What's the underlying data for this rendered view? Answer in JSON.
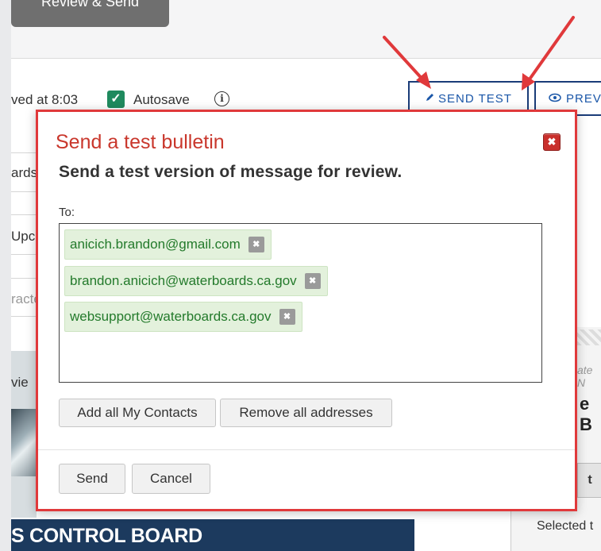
{
  "background": {
    "review_button": "Review & Send",
    "saved_text": "ved at 8:03",
    "autosave_label": "Autosave",
    "info_icon": "i",
    "send_test_label": "SEND TEST",
    "preview_label": "PREV",
    "left_tabs": [
      "ards",
      "Upc",
      "racte"
    ],
    "hero_text": "vie",
    "banner_text": "S CONTROL BOARD",
    "right_small": "ate N",
    "right_bold": "e B",
    "right_box": "t",
    "right_selected": "Selected t"
  },
  "modal": {
    "title": "Send a test bulletin",
    "close": "✖",
    "subtitle": "Send a test version of message for review.",
    "to_label": "To:",
    "recipients": [
      "anicich.brandon@gmail.com",
      "brandon.anicich@waterboards.ca.gov",
      "websupport@waterboards.ca.gov"
    ],
    "chip_remove": "✖",
    "add_all_label": "Add all My Contacts",
    "remove_all_label": "Remove all addresses",
    "send_label": "Send",
    "cancel_label": "Cancel"
  },
  "colors": {
    "accent_red": "#e0393b",
    "title_red": "#c9372c",
    "chip_green_bg": "#e3f1dc",
    "chip_green_text": "#237a2b",
    "autosave_green": "#1f8a5e",
    "button_blue": "#1a56a8"
  },
  "icons": {
    "close": "close-icon",
    "pencil": "pencil-icon",
    "eye": "eye-icon",
    "info": "info-icon",
    "check": "check-icon"
  }
}
